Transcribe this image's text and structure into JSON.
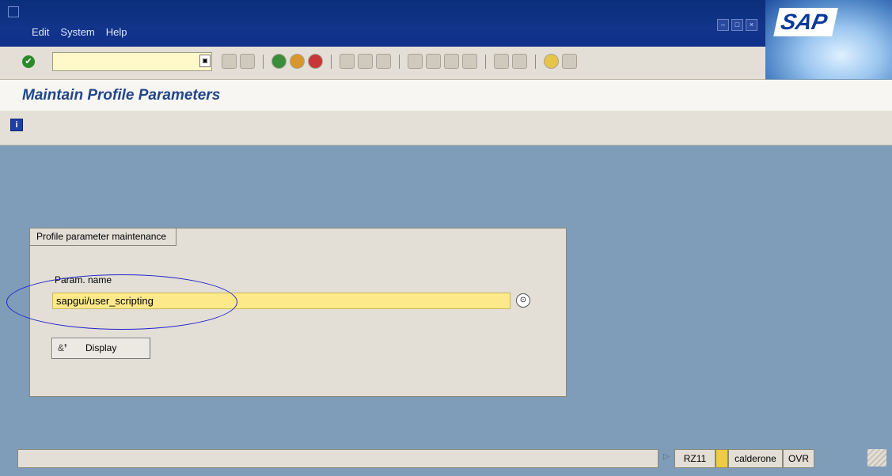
{
  "menu": [
    "Edit",
    "System",
    "Help"
  ],
  "window_buttons": [
    "–",
    "□",
    "×"
  ],
  "logo_text": "SAP",
  "toolbar": {
    "command_value": "",
    "command_button": "▣",
    "ok_icon": "✔",
    "icons": [
      "back-small",
      "save-icon",
      "back-icon",
      "exit-icon",
      "cancel-icon",
      "print-icon",
      "find-icon",
      "find-next-icon",
      "first-page-icon",
      "prev-page-icon",
      "next-page-icon",
      "last-page-icon",
      "create-session-icon",
      "shortcut-icon",
      "help-icon",
      "layout-menu-icon"
    ]
  },
  "title": "Maintain Profile Parameters",
  "app_toolbar": {
    "info_icon": "i"
  },
  "group": {
    "title": "Profile parameter maintenance",
    "param_label": "Param. name",
    "param_value": "sapgui/user_scripting",
    "f4_icon": "⊙",
    "display_icon": "&❜",
    "display_label": "Display"
  },
  "status": {
    "arrow": "▷",
    "transaction": "RZ11",
    "user": "calderone",
    "mode": "OVR"
  },
  "colors": {
    "background": "#7f9db9",
    "menu_band": "#0a2f7a",
    "panel": "#e3dfd6",
    "input_focus": "#fde98a",
    "title_text": "#22468a",
    "annotation": "#2222cc"
  }
}
